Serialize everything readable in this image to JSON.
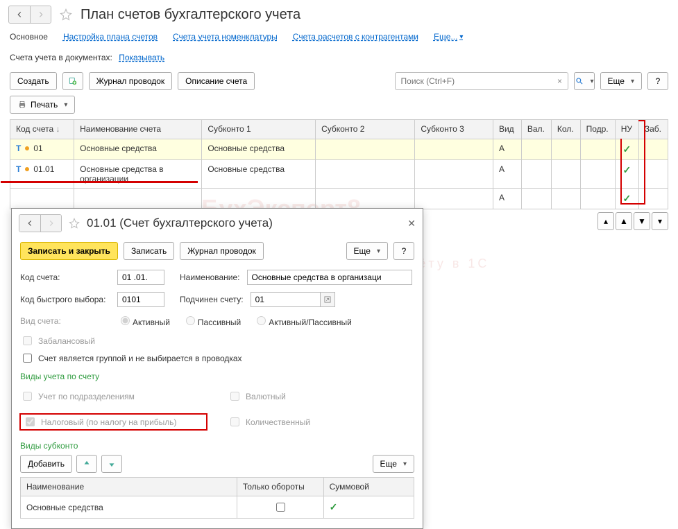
{
  "header": {
    "title": "План счетов бухгалтерского учета"
  },
  "nav": {
    "main": "Основное",
    "tune": "Настройка плана счетов",
    "noml": "Счета учета номенклатуры",
    "contragent": "Счета расчетов с контрагентами",
    "more": "Еще..."
  },
  "filter": {
    "label": "Счета учета в документах:",
    "value": "Показывать"
  },
  "toolbar": {
    "create": "Создать",
    "journal": "Журнал проводок",
    "desc": "Описание счета",
    "search_placeholder": "Поиск (Ctrl+F)",
    "more": "Еще",
    "print": "Печать"
  },
  "grid": {
    "cols": {
      "code": "Код счета",
      "name": "Наименование счета",
      "sub1": "Субконто 1",
      "sub2": "Субконто 2",
      "sub3": "Субконто 3",
      "kind": "Вид",
      "val": "Вал.",
      "kol": "Кол.",
      "podr": "Подр.",
      "nu": "НУ",
      "zab": "Заб."
    },
    "rows": [
      {
        "code": "01",
        "name": "Основные средства",
        "sub1": "Основные средства",
        "kind": "А",
        "nu": true
      },
      {
        "code": "01.01",
        "name": "Основные средства в организации",
        "sub1": "Основные средства",
        "kind": "А",
        "nu": true
      },
      {
        "code": "",
        "name": "",
        "sub1": "",
        "kind": "А",
        "nu": true
      }
    ]
  },
  "dialog": {
    "title": "01.01 (Счет бухгалтерского учета)",
    "buttons": {
      "save_close": "Записать и закрыть",
      "save": "Записать",
      "journal": "Журнал проводок",
      "more": "Еще"
    },
    "fields": {
      "code_label": "Код счета:",
      "code_value": "01 .01.",
      "name_label": "Наименование:",
      "name_value": "Основные средства в организаци",
      "quick_label": "Код быстрого выбора:",
      "quick_value": "0101",
      "parent_label": "Подчинен счету:",
      "parent_value": "01",
      "kind_label": "Вид счета:",
      "kind_active": "Активный",
      "kind_passive": "Пассивный",
      "kind_ap": "Активный/Пассивный",
      "offbalance": "Забалансовый",
      "group_cbx": "Счет является группой и не выбирается в проводках"
    },
    "sections": {
      "types_title": "Виды учета по счету",
      "by_podr": "Учет по подразделениям",
      "tax": "Налоговый (по налогу на прибыль)",
      "currency": "Валютный",
      "qty": "Количественный",
      "subconto_title": "Виды субконто",
      "add": "Добавить",
      "more": "Еще"
    },
    "subconto": {
      "cols": {
        "name": "Наименование",
        "onlyturn": "Только обороты",
        "sum": "Суммовой"
      },
      "rows": [
        {
          "name": "Основные средства",
          "onlyturn": false,
          "sum": true
        }
      ]
    }
  },
  "watermark": {
    "big": "БухЭксперт8",
    "small": "чёту в 1С"
  }
}
